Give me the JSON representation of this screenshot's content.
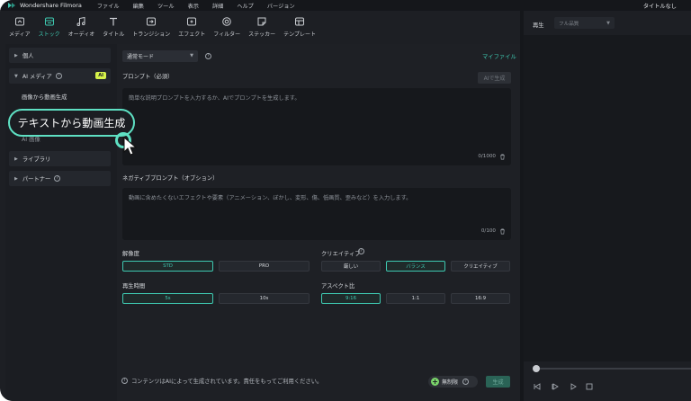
{
  "app": {
    "name": "Wondershare Filmora",
    "title_right": "タイトルなし"
  },
  "menu": [
    "ファイル",
    "編集",
    "ツール",
    "表示",
    "詳細",
    "ヘルプ",
    "バージョン"
  ],
  "toolbar": [
    {
      "label": "メディア",
      "icon": "media-icon"
    },
    {
      "label": "ストック",
      "icon": "stock-icon",
      "active": true
    },
    {
      "label": "オーディオ",
      "icon": "audio-icon"
    },
    {
      "label": "タイトル",
      "icon": "title-icon"
    },
    {
      "label": "トランジション",
      "icon": "transition-icon"
    },
    {
      "label": "エフェクト",
      "icon": "effect-icon"
    },
    {
      "label": "フィルター",
      "icon": "filter-icon"
    },
    {
      "label": "ステッカー",
      "icon": "sticker-icon"
    },
    {
      "label": "テンプレート",
      "icon": "template-icon"
    }
  ],
  "sidebar": {
    "personal": "個人",
    "ai_media": "AI メディア",
    "ai_badge": "AI",
    "sub_items": [
      "画像から動画生成",
      "テキストから動画生成"
    ],
    "sub_items_partial": "AI 画像",
    "library": "ライブラリ",
    "partner": "パートナー"
  },
  "callout": {
    "text": "テキストから動画生成"
  },
  "main": {
    "mode_select": "通常モード",
    "my_files": "マイファイル",
    "prompt_label": "プロンプト（必須）",
    "ai_generate_button": "AIで生成",
    "prompt_placeholder": "簡単な説明プロンプトを入力するか、AIでプロンプトを生成します。",
    "prompt_counter": "0/1000",
    "negative_label": "ネガティブプロンプト（オプション）",
    "negative_placeholder": "動画に含めたくないエフェクトや要素（アニメーション、ぼかし、変形、傷、低画質、歪みなど）を入力します。",
    "negative_counter": "0/100",
    "resolution": {
      "label": "解像度",
      "options": [
        "STD",
        "PRO"
      ],
      "selected": "STD"
    },
    "creative": {
      "label": "クリエイティブ",
      "options": [
        "厳しい",
        "バランス",
        "クリエイティブ"
      ],
      "selected": "バランス"
    },
    "duration": {
      "label": "再生時間",
      "options": [
        "5s",
        "10s"
      ],
      "selected": "5s"
    },
    "aspect": {
      "label": "アスペクト比",
      "options": [
        "9:16",
        "1:1",
        "16:9"
      ],
      "selected": "9:16"
    },
    "footer_note": "コンテンツはAIによって生成されています。責任をもってご利用ください。",
    "free_button": "無制限",
    "generate_button": "生成"
  },
  "preview": {
    "label": "再生",
    "quality": "フル品質"
  },
  "colors": {
    "accent": "#3ec8b0",
    "callout": "#5ee0c3",
    "badge": "#d6f24a"
  }
}
